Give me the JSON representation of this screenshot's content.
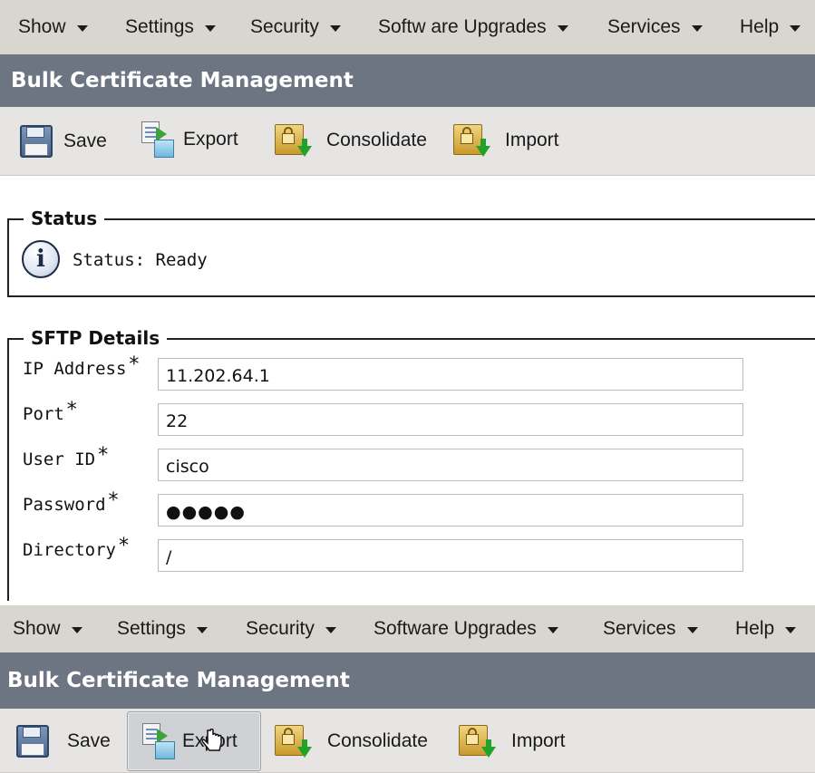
{
  "top_panel": {
    "menu": [
      {
        "label": "Show"
      },
      {
        "label": "Settings"
      },
      {
        "label": "Security"
      },
      {
        "label": "Softw are Upgrades"
      },
      {
        "label": "Services"
      },
      {
        "label": "Help"
      }
    ],
    "title": "Bulk Certificate Management",
    "toolbar": {
      "save": "Save",
      "export": "Export",
      "consolidate": "Consolidate",
      "import": "Import"
    },
    "status": {
      "legend": "Status",
      "text": "Status: Ready",
      "icon": "info-icon"
    },
    "sftp": {
      "legend": "SFTP Details",
      "required_mark": "*",
      "fields": [
        {
          "label": "IP Address",
          "value": "11.202.64.1"
        },
        {
          "label": "Port",
          "value": "22"
        },
        {
          "label": "User ID",
          "value": "cisco"
        },
        {
          "label": "Password",
          "value": "●●●●●"
        },
        {
          "label": "Directory",
          "value": "/"
        }
      ]
    }
  },
  "bottom_panel": {
    "menu": [
      {
        "label": "Show"
      },
      {
        "label": "Settings"
      },
      {
        "label": "Security"
      },
      {
        "label": "Software Upgrades"
      },
      {
        "label": "Services"
      },
      {
        "label": "Help"
      }
    ],
    "title": "Bulk Certificate Management",
    "toolbar": {
      "save": "Save",
      "export": "Export",
      "consolidate": "Consolidate",
      "import": "Import"
    }
  },
  "colors": {
    "menubar_bg": "#d9d6cf",
    "titlebar_bg": "#6d7583",
    "toolbar_bg": "#e6e5e3",
    "title_text": "#ffffff"
  }
}
